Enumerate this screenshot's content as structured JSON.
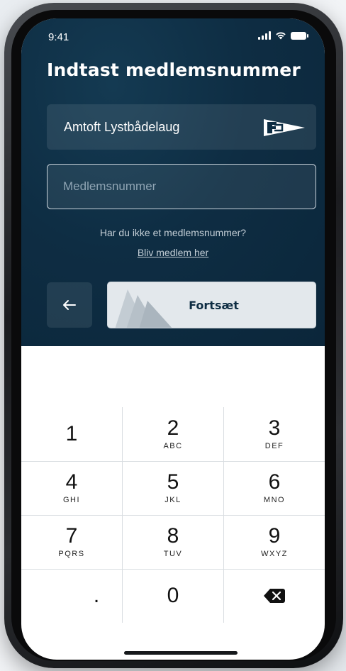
{
  "status_bar": {
    "time": "9:41",
    "icons": [
      "cellular-signal-icon",
      "wifi-icon",
      "battery-icon"
    ]
  },
  "page": {
    "title": "Indtast medlemsnummer"
  },
  "club": {
    "name": "Amtoft Lystbådelaug",
    "icon": "burgee-flag-icon"
  },
  "member_field": {
    "placeholder": "Medlemsnummer",
    "value": ""
  },
  "signup": {
    "question": "Har du ikke et medlemsnummer?",
    "link_label": "Bliv medlem her"
  },
  "actions": {
    "back_icon": "arrow-left-icon",
    "continue_label": "Fortsæt"
  },
  "keypad": {
    "keys": [
      {
        "num": "1",
        "letters": ""
      },
      {
        "num": "2",
        "letters": "ABC"
      },
      {
        "num": "3",
        "letters": "DEF"
      },
      {
        "num": "4",
        "letters": "GHI"
      },
      {
        "num": "5",
        "letters": "JKL"
      },
      {
        "num": "6",
        "letters": "MNO"
      },
      {
        "num": "7",
        "letters": "PQRS"
      },
      {
        "num": "8",
        "letters": "TUV"
      },
      {
        "num": "9",
        "letters": "WXYZ"
      },
      {
        "num": ".",
        "letters": ""
      },
      {
        "num": "0",
        "letters": ""
      },
      {
        "num": "",
        "letters": ""
      }
    ],
    "delete_icon": "backspace-icon"
  },
  "colors": {
    "background_top": "#0e2d43",
    "continue_button": "#e3e8ec",
    "text_on_dark": "#ffffff"
  }
}
